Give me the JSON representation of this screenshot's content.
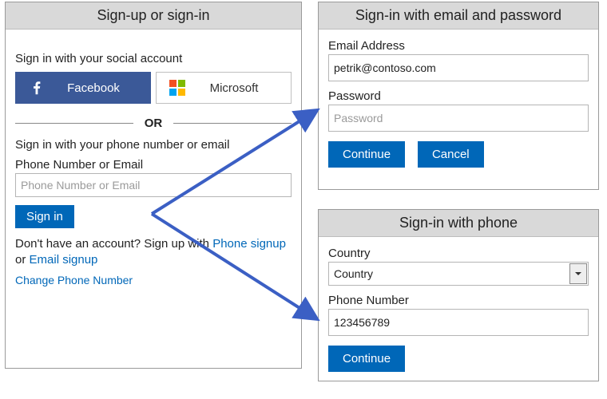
{
  "main": {
    "title": "Sign-up or sign-in",
    "social_prompt": "Sign in with your social account",
    "facebook_label": "Facebook",
    "microsoft_label": "Microsoft",
    "or_text": "OR",
    "local_prompt": "Sign in with your phone number or email",
    "local_field_label": "Phone Number or Email",
    "local_field_placeholder": "Phone Number or Email",
    "signin_label": "Sign in",
    "signup_prefix": "Don't have an account? Sign up with ",
    "phone_signup_link": "Phone signup",
    "or_word": " or ",
    "email_signup_link": "Email signup",
    "change_phone_link": "Change Phone Number"
  },
  "email_panel": {
    "title": "Sign-in with email and password",
    "email_label": "Email Address",
    "email_value": "petrik@contoso.com",
    "password_label": "Password",
    "password_placeholder": "Password",
    "continue_label": "Continue",
    "cancel_label": "Cancel"
  },
  "phone_panel": {
    "title": "Sign-in with phone",
    "country_label": "Country",
    "country_value": "Country",
    "phone_label": "Phone Number",
    "phone_value": "123456789",
    "continue_label": "Continue"
  },
  "colors": {
    "primary": "#0067b8",
    "facebook": "#3b5998",
    "header_bg": "#d9d9d9",
    "arrow": "#3b5fc4"
  }
}
